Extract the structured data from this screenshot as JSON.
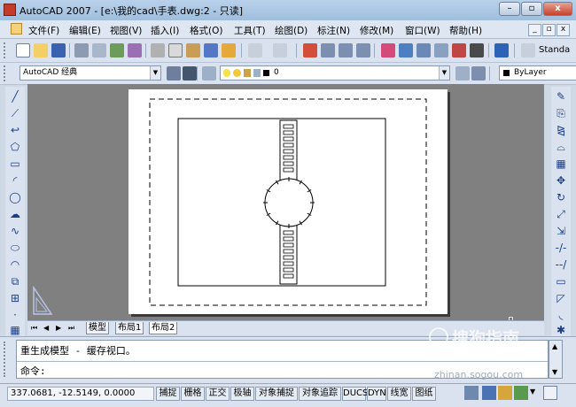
{
  "window": {
    "title": "AutoCAD 2007 - [e:\\我的cad\\手表.dwg:2 - 只读]",
    "minimize_glyph": "–",
    "restore_glyph": "▫",
    "close_glyph": "x"
  },
  "menu": {
    "items": [
      "文件(F)",
      "编辑(E)",
      "视图(V)",
      "插入(I)",
      "格式(O)",
      "工具(T)",
      "绘图(D)",
      "标注(N)",
      "修改(M)",
      "窗口(W)",
      "帮助(H)"
    ],
    "doc_controls": [
      "_",
      "▫",
      "x"
    ]
  },
  "toolbar": {
    "standard_label_truncated": "Standa",
    "workspace": "AutoCAD 经典",
    "layer_value": "0",
    "color_value": "ByLayer"
  },
  "tabs": {
    "nav": [
      "⏮",
      "◀",
      "▶",
      "⏭"
    ],
    "model": "模型",
    "layout1": "布局1",
    "layout2": "布局2"
  },
  "command": {
    "history_line": "重生成模型 - 缓存视口。",
    "prompt": "命令:"
  },
  "status": {
    "coordinates": "337.0681, -12.5149, 0.0000",
    "toggles": [
      "捕捉",
      "栅格",
      "正交",
      "极轴",
      "对象捕捉",
      "对象追踪",
      "DUCS",
      "DYN",
      "线宽",
      "图纸"
    ]
  },
  "watermark": {
    "text": "搜狗指南",
    "url": "zhinan.sogou.com"
  }
}
